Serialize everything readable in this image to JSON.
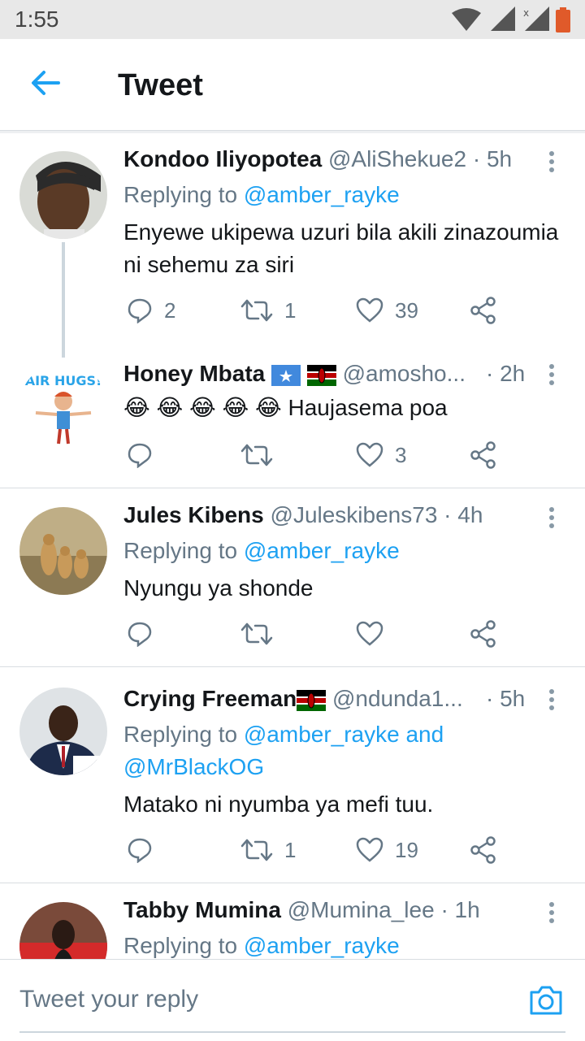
{
  "status_bar": {
    "time": "1:55"
  },
  "header": {
    "title": "Tweet"
  },
  "tweets": [
    {
      "name": "Kondoo Iliyopotea",
      "handle": "@AliShekue2",
      "time": "· 5h",
      "replying_prefix": "Replying to",
      "replying_to": "@amber_rayke",
      "text": "Enyewe ukipewa uzuri bila akili zinazoumia ni sehemu za siri",
      "replies": "2",
      "retweets": "1",
      "likes": "39"
    },
    {
      "name": "Honey Mbata",
      "handle": "@amosho...",
      "time": "· 2h",
      "avatar_text": "AIR HUGS!",
      "text": "😂 😂 😂 😂 😂 Haujasema poa",
      "replies": "",
      "retweets": "",
      "likes": "3"
    },
    {
      "name": "Jules Kibens",
      "handle": "@Juleskibens73",
      "time": "· 4h",
      "replying_prefix": "Replying to",
      "replying_to": "@amber_rayke",
      "text": "Nyungu ya shonde",
      "replies": "",
      "retweets": "",
      "likes": ""
    },
    {
      "name": "Crying Freeman",
      "handle": "@ndunda1...",
      "time": "· 5h",
      "replying_prefix": "Replying to",
      "replying_to": "@amber_rayke and",
      "replying_to_2": "@MrBlackOG",
      "text": "Matako ni nyumba ya mefi tuu.",
      "replies": "",
      "retweets": "1",
      "likes": "19"
    },
    {
      "name": "Tabby Mumina",
      "handle": "@Mumina_lee",
      "time": "· 1h",
      "replying_prefix": "Replying to",
      "replying_to": "@amber_rayke"
    }
  ],
  "reply_bar": {
    "placeholder": "Tweet your reply"
  },
  "colors": {
    "accent": "#1da1f2",
    "muted": "#657786",
    "text": "#14171a",
    "divider": "#d8dde1"
  },
  "icons": [
    "back-arrow-icon",
    "reply-icon",
    "retweet-icon",
    "like-icon",
    "share-icon",
    "more-icon",
    "camera-icon",
    "wifi-icon",
    "signal-icon",
    "battery-icon"
  ]
}
